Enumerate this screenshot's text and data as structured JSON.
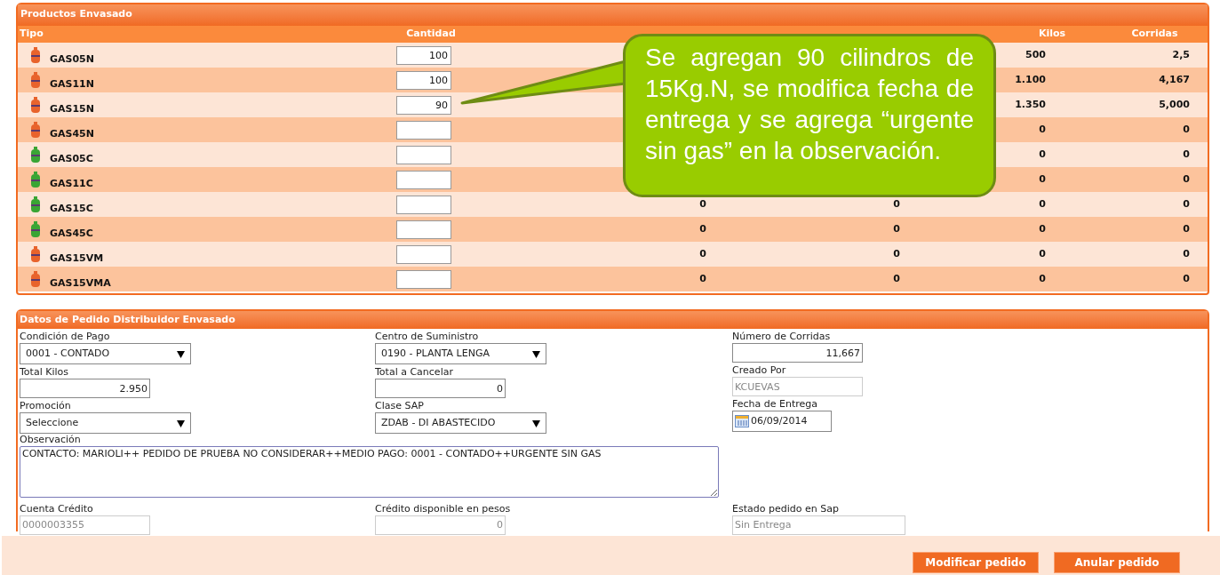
{
  "products_panel": {
    "title": "Productos Envasado",
    "columns": [
      "Tipo",
      "Cantidad",
      "Kilos",
      "Corridas"
    ],
    "rows": [
      {
        "tipo": "GAS05N",
        "color": "#e8632c",
        "cantidad": "100",
        "kilos": "500",
        "corridas": "2,5"
      },
      {
        "tipo": "GAS11N",
        "color": "#e8632c",
        "cantidad": "100",
        "kilos": "1.100",
        "corridas": "4,167"
      },
      {
        "tipo": "GAS15N",
        "color": "#e8632c",
        "cantidad": "90",
        "kilos": "1.350",
        "corridas": "5,000"
      },
      {
        "tipo": "GAS45N",
        "color": "#e8632c",
        "kilos": "0",
        "corridas": "0"
      },
      {
        "tipo": "GAS05C",
        "color": "#3aa534",
        "kilos": "0",
        "corridas": "0"
      },
      {
        "tipo": "GAS11C",
        "color": "#3aa534",
        "kilos": "0",
        "corridas": "0"
      },
      {
        "tipo": "GAS15C",
        "color": "#3aa534",
        "column_3": "0",
        "column_4": "0",
        "kilos": "0",
        "corridas": "0"
      },
      {
        "tipo": "GAS45C",
        "color": "#3aa534",
        "column_3": "0",
        "column_4": "0",
        "kilos": "0",
        "corridas": "0"
      },
      {
        "tipo": "GAS15VM",
        "color": "#e8632c",
        "column_3": "0",
        "column_4": "0",
        "kilos": "0",
        "corridas": "0"
      },
      {
        "tipo": "GAS15VMA",
        "color": "#e8632c",
        "column_3": "0",
        "column_4": "0",
        "kilos": "0",
        "corridas": "0"
      }
    ]
  },
  "callout": "Se agregan 90 cilindros de 15Kg.N, se modifica fecha de entrega y se agrega “urgente sin gas” en la observación.",
  "order_panel": {
    "title": "Datos de Pedido Distribuidor Envasado",
    "columns": [
      [
        {
          "label": "Condición de Pago",
          "kind": "select",
          "value": "0001 - CONTADO"
        },
        {
          "label": "Total Kilos",
          "kind": "input",
          "value": "2.950"
        },
        {
          "label": "Promoción",
          "kind": "select",
          "value": "Seleccione"
        }
      ],
      [
        {
          "label": "Centro de Suministro",
          "kind": "select",
          "value": "0190 - PLANTA LENGA"
        },
        {
          "label": "Total a Cancelar",
          "kind": "input",
          "value": "0"
        },
        {
          "label": "Clase SAP",
          "kind": "select",
          "value": "ZDAB - DI ABASTECIDO"
        }
      ],
      [
        {
          "label": "Número de Corridas",
          "kind": "input",
          "value": "11,667"
        },
        {
          "label": "Creado Por",
          "kind": "readonly",
          "value": "KCUEVAS"
        },
        {
          "label": "Fecha de Entrega",
          "kind": "date",
          "value": "06/09/2014"
        }
      ]
    ],
    "observacion": {
      "label": "Observación",
      "value": "CONTACTO: MARIOLI++ PEDIDO DE PRUEBA NO CONSIDERAR++MEDIO PAGO: 0001 - CONTADO++URGENTE SIN GAS"
    },
    "bottom_fields": [
      {
        "label": "Cuenta Crédito",
        "value": "0000003355",
        "kind": "text"
      },
      {
        "label": "Crédito disponible en pesos",
        "value": "0",
        "kind": "number"
      },
      {
        "label": "Estado pedido en Sap",
        "value": "Sin Entrega",
        "kind": "text"
      }
    ]
  },
  "buttons": [
    "Modificar pedido",
    "Anular pedido"
  ]
}
